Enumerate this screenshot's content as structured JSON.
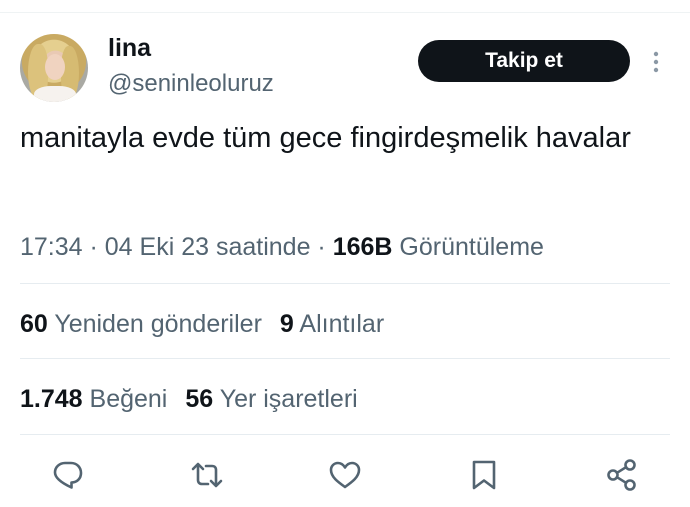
{
  "user": {
    "name": "lina",
    "handle": "@seninleoluruz"
  },
  "follow_button": {
    "label": "Takip et"
  },
  "tweet": {
    "text": "manitayla evde tüm gece fingirdeşmelik havalar"
  },
  "meta": {
    "time": "17:34",
    "sep1": " · ",
    "date": "04 Eki 23 saatinde",
    "sep2": " · ",
    "views_count": "166B",
    "views_label": "Görüntüleme"
  },
  "stats": {
    "retweets_count": "60",
    "retweets_label": "Yeniden gönderiler",
    "quotes_count": "9",
    "quotes_label": "Alıntılar",
    "likes_count": "1.748",
    "likes_label": "Beğeni",
    "bookmarks_count": "56",
    "bookmarks_label": "Yer işaretleri"
  },
  "icons": {
    "more": "more-vertical-icon",
    "reply": "reply-icon",
    "retweet": "retweet-icon",
    "like": "heart-icon",
    "bookmark": "bookmark-icon",
    "share": "share-icon"
  },
  "colors": {
    "text_primary": "#0f1419",
    "text_secondary": "#536471",
    "divider": "#e6ecf0",
    "button_bg": "#0f1419",
    "icon": "#536471"
  }
}
